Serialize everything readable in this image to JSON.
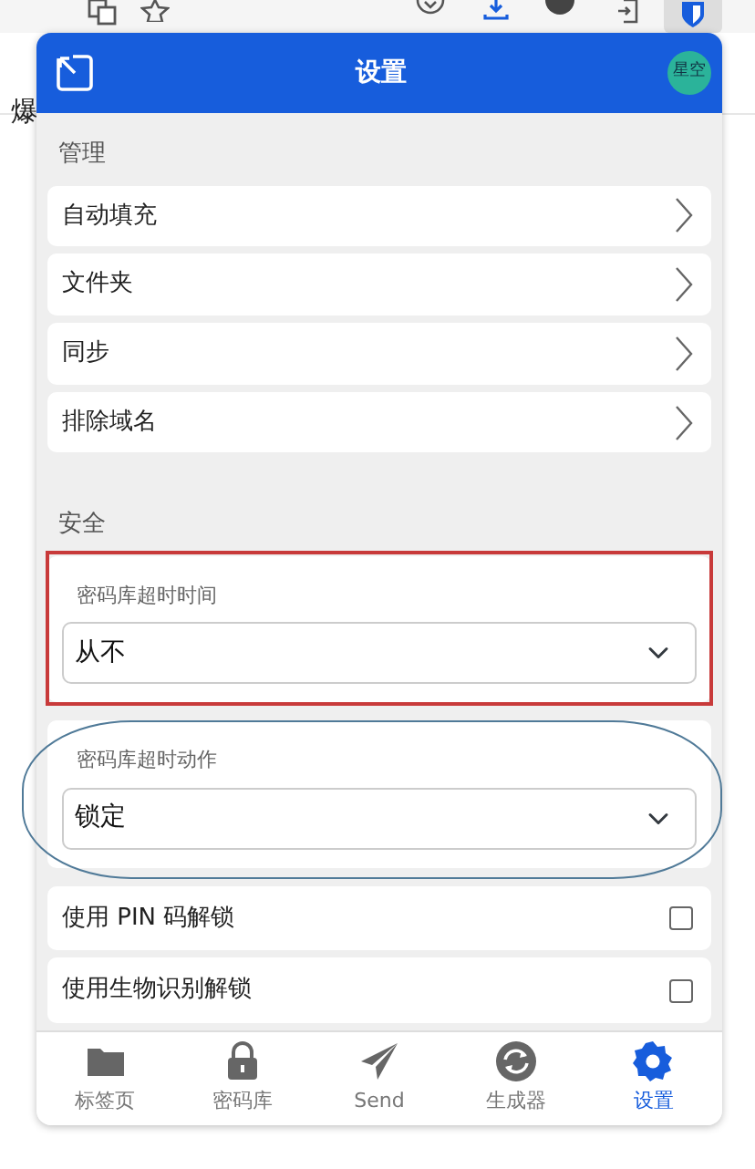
{
  "browser": {
    "page_text": "爆"
  },
  "popup": {
    "title": "设置",
    "avatar": "星空"
  },
  "sections": [
    {
      "title": "管理",
      "items": [
        {
          "kind": "link",
          "label": "自动填充"
        },
        {
          "kind": "link",
          "label": "文件夹"
        },
        {
          "kind": "link",
          "label": "同步"
        },
        {
          "kind": "link",
          "label": "排除域名"
        }
      ]
    },
    {
      "title": "安全",
      "items": [
        {
          "kind": "boxed-select",
          "label": "密码库超时时间",
          "value": "从不"
        },
        {
          "kind": "circled-select",
          "label": "密码库超时动作",
          "value": "锁定"
        },
        {
          "kind": "checkbox",
          "label": "使用 PIN 码解锁",
          "checked": false
        },
        {
          "kind": "checkbox",
          "label": "使用生物识别解锁",
          "checked": false
        }
      ]
    }
  ],
  "tabs": [
    {
      "label": "标签页",
      "selected": false
    },
    {
      "label": "密码库",
      "selected": false
    },
    {
      "label": "Send",
      "selected": false
    },
    {
      "label": "生成器",
      "selected": false
    },
    {
      "label": "设置",
      "selected": true
    }
  ]
}
